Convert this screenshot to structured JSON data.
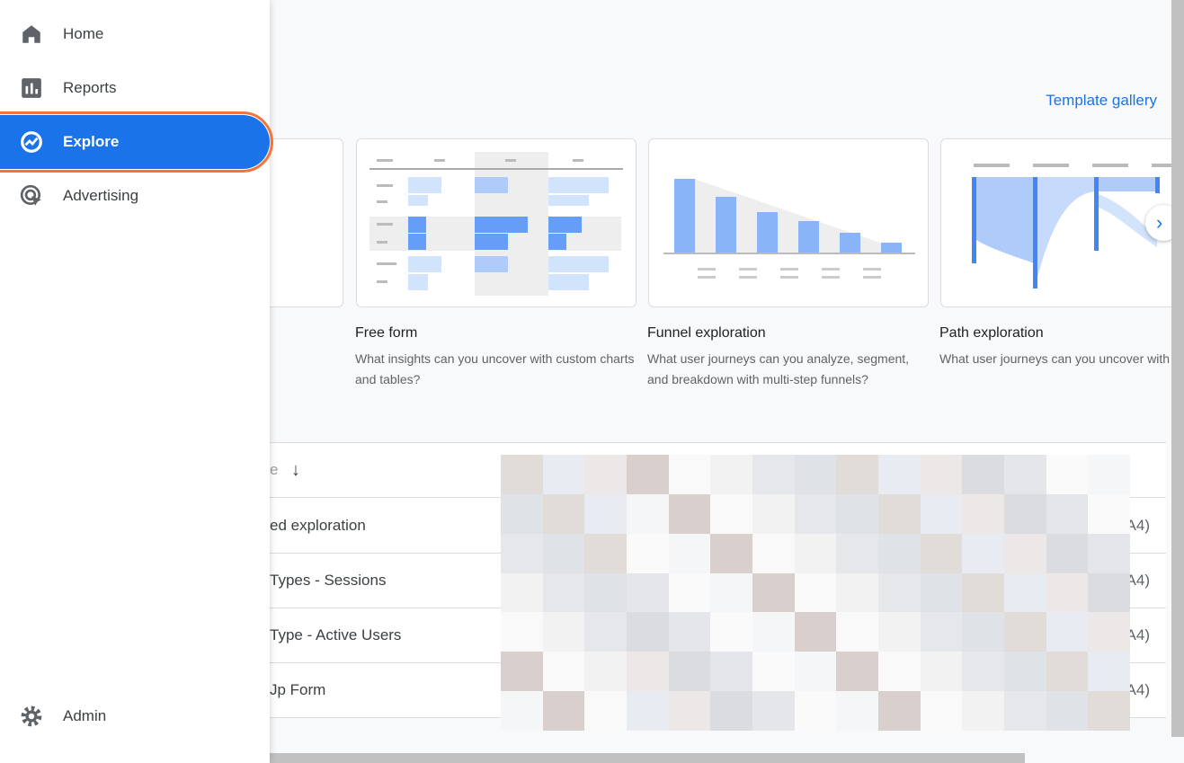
{
  "sidebar": {
    "items": [
      {
        "label": "Home",
        "icon": "home-icon"
      },
      {
        "label": "Reports",
        "icon": "bar-chart-icon"
      },
      {
        "label": "Explore",
        "icon": "explore-icon",
        "active": true
      },
      {
        "label": "Advertising",
        "icon": "advertising-icon"
      }
    ],
    "admin": {
      "label": "Admin",
      "icon": "gear-icon"
    }
  },
  "main": {
    "template_gallery": "Template gallery",
    "templates": [
      {
        "title": "Free form",
        "description": "What insights can you uncover with custom charts and tables?"
      },
      {
        "title": "Funnel exploration",
        "description": "What user journeys can you analyze, segment, and breakdown with multi-step funnels?"
      },
      {
        "title": "Path exploration",
        "description": "What user journeys can you uncover with graphs?"
      }
    ],
    "table": {
      "header_partial": "e",
      "sort_icon": "arrow-down-icon",
      "rows": [
        {
          "name": "ed exploration",
          "end": "A4)"
        },
        {
          "name": " Types - Sessions",
          "end": "A4)"
        },
        {
          "name": " Type - Active Users",
          "end": "A4)"
        },
        {
          "name": "Jp Form",
          "end": "A4)"
        }
      ]
    },
    "colors": {
      "accent": "#1a73e8",
      "highlight": "#f4743b"
    }
  }
}
